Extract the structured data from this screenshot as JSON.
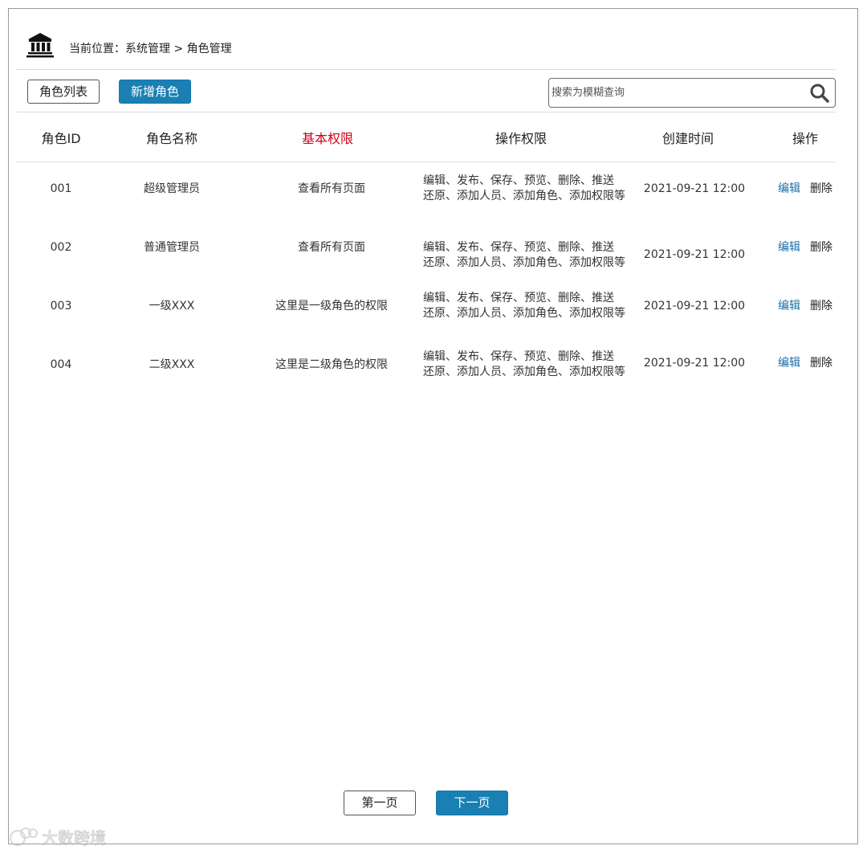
{
  "breadcrumb": {
    "icon": "bank-building-icon",
    "text": "当前位置：系统管理 > 角色管理"
  },
  "toolbar": {
    "role_list_label": "角色列表",
    "add_role_label": "新增角色",
    "search_placeholder": "搜索为模糊查询",
    "search_icon": "search-icon"
  },
  "table": {
    "headers": {
      "role_id": "角色ID",
      "role_name": "角色名称",
      "basic_permissions": "基本权限",
      "operation_permissions": "操作权限",
      "created_time": "创建时间",
      "actions": "操作"
    },
    "rows": [
      {
        "id": "001",
        "name": "超级管理员",
        "basic": "查看所有页面",
        "ops_line1": "编辑、发布、保存、预览、删除、推送",
        "ops_line2": "还原、添加人员、添加角色、添加权限等",
        "created": "2021-09-21 12:00",
        "edit": "编辑",
        "delete": "删除"
      },
      {
        "id": "002",
        "name": "普通管理员",
        "basic": "查看所有页面",
        "ops_line1": "编辑、发布、保存、预览、删除、推送",
        "ops_line2": "还原、添加人员、添加角色、添加权限等",
        "created": "2021-09-21 12:00",
        "edit": "编辑",
        "delete": "删除"
      },
      {
        "id": "003",
        "name": "一级XXX",
        "basic": "这里是一级角色的权限",
        "ops_line1": "编辑、发布、保存、预览、删除、推送",
        "ops_line2": "还原、添加人员、添加角色、添加权限等",
        "created": "2021-09-21 12:00",
        "edit": "编辑",
        "delete": "删除"
      },
      {
        "id": "004",
        "name": "二级XXX",
        "basic": "这里是二级角色的权限",
        "ops_line1": "编辑、发布、保存、预览、删除、推送",
        "ops_line2": "还原、添加人员、添加角色、添加权限等",
        "created": "2021-09-21 12:00",
        "edit": "编辑",
        "delete": "删除"
      }
    ]
  },
  "pagination": {
    "first_label": "第一页",
    "next_label": "下一页"
  },
  "colors": {
    "primary": "#1a7fb3",
    "highlight_header": "#d0021b",
    "edit_link": "#1a6fa8"
  },
  "watermark": {
    "text": "大数跨境"
  }
}
